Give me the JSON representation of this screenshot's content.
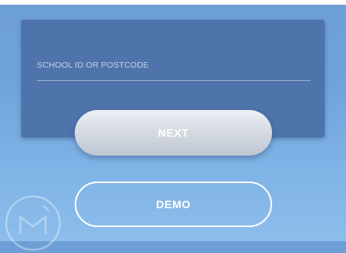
{
  "form": {
    "school_field": {
      "placeholder": "SCHOOL ID OR POSTCODE",
      "value": ""
    },
    "next_label": "NEXT",
    "demo_label": "DEMO"
  },
  "colors": {
    "background": "#6fa3da",
    "card": "#4f74ab",
    "next_button": "#d6dbe3",
    "text": "#ffffff"
  },
  "icons": {
    "watermark": "logo-watermark-icon"
  }
}
